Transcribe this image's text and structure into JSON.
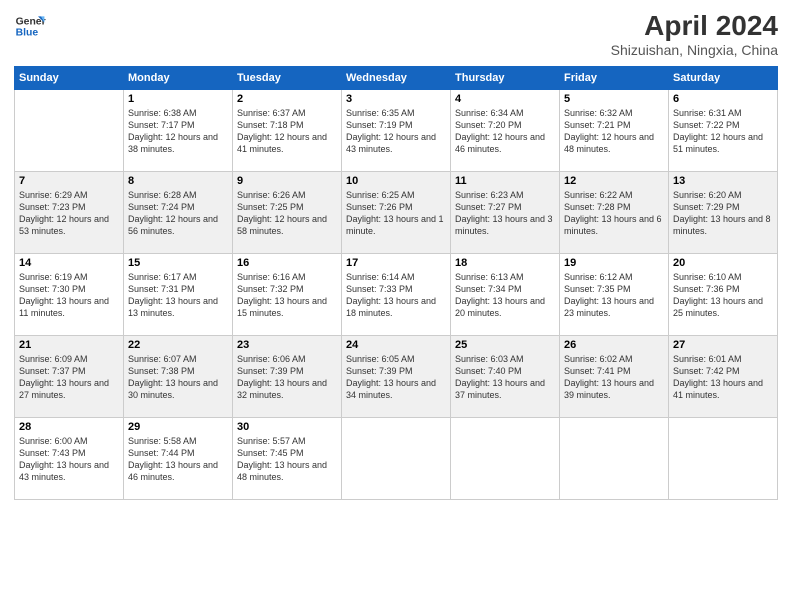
{
  "header": {
    "logo_line1": "General",
    "logo_line2": "Blue",
    "month": "April 2024",
    "location": "Shizuishan, Ningxia, China"
  },
  "weekdays": [
    "Sunday",
    "Monday",
    "Tuesday",
    "Wednesday",
    "Thursday",
    "Friday",
    "Saturday"
  ],
  "weeks": [
    [
      {
        "day": "",
        "sunrise": "",
        "sunset": "",
        "daylight": ""
      },
      {
        "day": "1",
        "sunrise": "Sunrise: 6:38 AM",
        "sunset": "Sunset: 7:17 PM",
        "daylight": "Daylight: 12 hours and 38 minutes."
      },
      {
        "day": "2",
        "sunrise": "Sunrise: 6:37 AM",
        "sunset": "Sunset: 7:18 PM",
        "daylight": "Daylight: 12 hours and 41 minutes."
      },
      {
        "day": "3",
        "sunrise": "Sunrise: 6:35 AM",
        "sunset": "Sunset: 7:19 PM",
        "daylight": "Daylight: 12 hours and 43 minutes."
      },
      {
        "day": "4",
        "sunrise": "Sunrise: 6:34 AM",
        "sunset": "Sunset: 7:20 PM",
        "daylight": "Daylight: 12 hours and 46 minutes."
      },
      {
        "day": "5",
        "sunrise": "Sunrise: 6:32 AM",
        "sunset": "Sunset: 7:21 PM",
        "daylight": "Daylight: 12 hours and 48 minutes."
      },
      {
        "day": "6",
        "sunrise": "Sunrise: 6:31 AM",
        "sunset": "Sunset: 7:22 PM",
        "daylight": "Daylight: 12 hours and 51 minutes."
      }
    ],
    [
      {
        "day": "7",
        "sunrise": "Sunrise: 6:29 AM",
        "sunset": "Sunset: 7:23 PM",
        "daylight": "Daylight: 12 hours and 53 minutes."
      },
      {
        "day": "8",
        "sunrise": "Sunrise: 6:28 AM",
        "sunset": "Sunset: 7:24 PM",
        "daylight": "Daylight: 12 hours and 56 minutes."
      },
      {
        "day": "9",
        "sunrise": "Sunrise: 6:26 AM",
        "sunset": "Sunset: 7:25 PM",
        "daylight": "Daylight: 12 hours and 58 minutes."
      },
      {
        "day": "10",
        "sunrise": "Sunrise: 6:25 AM",
        "sunset": "Sunset: 7:26 PM",
        "daylight": "Daylight: 13 hours and 1 minute."
      },
      {
        "day": "11",
        "sunrise": "Sunrise: 6:23 AM",
        "sunset": "Sunset: 7:27 PM",
        "daylight": "Daylight: 13 hours and 3 minutes."
      },
      {
        "day": "12",
        "sunrise": "Sunrise: 6:22 AM",
        "sunset": "Sunset: 7:28 PM",
        "daylight": "Daylight: 13 hours and 6 minutes."
      },
      {
        "day": "13",
        "sunrise": "Sunrise: 6:20 AM",
        "sunset": "Sunset: 7:29 PM",
        "daylight": "Daylight: 13 hours and 8 minutes."
      }
    ],
    [
      {
        "day": "14",
        "sunrise": "Sunrise: 6:19 AM",
        "sunset": "Sunset: 7:30 PM",
        "daylight": "Daylight: 13 hours and 11 minutes."
      },
      {
        "day": "15",
        "sunrise": "Sunrise: 6:17 AM",
        "sunset": "Sunset: 7:31 PM",
        "daylight": "Daylight: 13 hours and 13 minutes."
      },
      {
        "day": "16",
        "sunrise": "Sunrise: 6:16 AM",
        "sunset": "Sunset: 7:32 PM",
        "daylight": "Daylight: 13 hours and 15 minutes."
      },
      {
        "day": "17",
        "sunrise": "Sunrise: 6:14 AM",
        "sunset": "Sunset: 7:33 PM",
        "daylight": "Daylight: 13 hours and 18 minutes."
      },
      {
        "day": "18",
        "sunrise": "Sunrise: 6:13 AM",
        "sunset": "Sunset: 7:34 PM",
        "daylight": "Daylight: 13 hours and 20 minutes."
      },
      {
        "day": "19",
        "sunrise": "Sunrise: 6:12 AM",
        "sunset": "Sunset: 7:35 PM",
        "daylight": "Daylight: 13 hours and 23 minutes."
      },
      {
        "day": "20",
        "sunrise": "Sunrise: 6:10 AM",
        "sunset": "Sunset: 7:36 PM",
        "daylight": "Daylight: 13 hours and 25 minutes."
      }
    ],
    [
      {
        "day": "21",
        "sunrise": "Sunrise: 6:09 AM",
        "sunset": "Sunset: 7:37 PM",
        "daylight": "Daylight: 13 hours and 27 minutes."
      },
      {
        "day": "22",
        "sunrise": "Sunrise: 6:07 AM",
        "sunset": "Sunset: 7:38 PM",
        "daylight": "Daylight: 13 hours and 30 minutes."
      },
      {
        "day": "23",
        "sunrise": "Sunrise: 6:06 AM",
        "sunset": "Sunset: 7:39 PM",
        "daylight": "Daylight: 13 hours and 32 minutes."
      },
      {
        "day": "24",
        "sunrise": "Sunrise: 6:05 AM",
        "sunset": "Sunset: 7:39 PM",
        "daylight": "Daylight: 13 hours and 34 minutes."
      },
      {
        "day": "25",
        "sunrise": "Sunrise: 6:03 AM",
        "sunset": "Sunset: 7:40 PM",
        "daylight": "Daylight: 13 hours and 37 minutes."
      },
      {
        "day": "26",
        "sunrise": "Sunrise: 6:02 AM",
        "sunset": "Sunset: 7:41 PM",
        "daylight": "Daylight: 13 hours and 39 minutes."
      },
      {
        "day": "27",
        "sunrise": "Sunrise: 6:01 AM",
        "sunset": "Sunset: 7:42 PM",
        "daylight": "Daylight: 13 hours and 41 minutes."
      }
    ],
    [
      {
        "day": "28",
        "sunrise": "Sunrise: 6:00 AM",
        "sunset": "Sunset: 7:43 PM",
        "daylight": "Daylight: 13 hours and 43 minutes."
      },
      {
        "day": "29",
        "sunrise": "Sunrise: 5:58 AM",
        "sunset": "Sunset: 7:44 PM",
        "daylight": "Daylight: 13 hours and 46 minutes."
      },
      {
        "day": "30",
        "sunrise": "Sunrise: 5:57 AM",
        "sunset": "Sunset: 7:45 PM",
        "daylight": "Daylight: 13 hours and 48 minutes."
      },
      {
        "day": "",
        "sunrise": "",
        "sunset": "",
        "daylight": ""
      },
      {
        "day": "",
        "sunrise": "",
        "sunset": "",
        "daylight": ""
      },
      {
        "day": "",
        "sunrise": "",
        "sunset": "",
        "daylight": ""
      },
      {
        "day": "",
        "sunrise": "",
        "sunset": "",
        "daylight": ""
      }
    ]
  ]
}
